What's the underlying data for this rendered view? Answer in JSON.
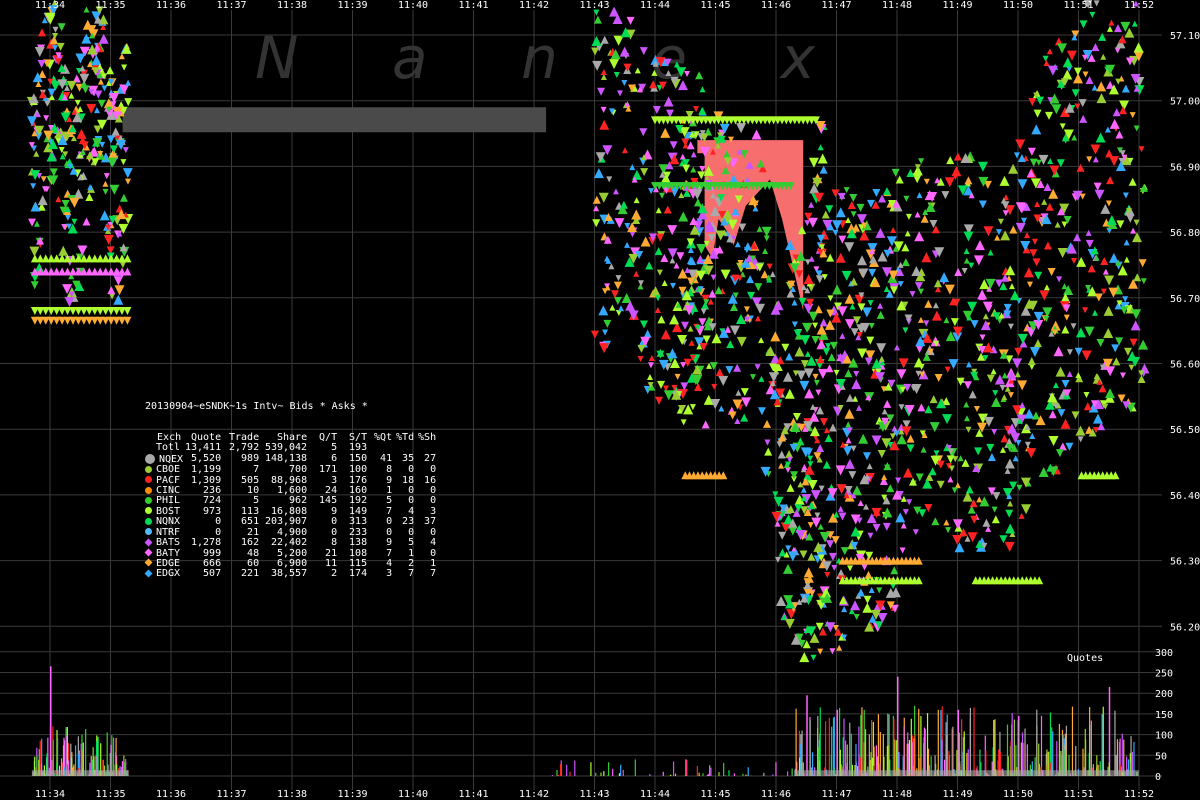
{
  "watermark": "N  a  n  e  x",
  "volume_label": "Quotes",
  "time_labels": [
    "11:34",
    "11:35",
    "11:36",
    "11:37",
    "11:38",
    "11:39",
    "11:40",
    "11:41",
    "11:42",
    "11:43",
    "11:44",
    "11:45",
    "11:46",
    "11:47",
    "11:48",
    "11:49",
    "11:50",
    "11:51",
    "11:52"
  ],
  "price_labels": [
    "57.10",
    "57.00",
    "56.90",
    "56.80",
    "56.70",
    "56.60",
    "56.50",
    "56.40",
    "56.30",
    "56.20"
  ],
  "volume_ticks": [
    "300",
    "250",
    "200",
    "150",
    "100",
    "50",
    "0"
  ],
  "colors": {
    "background": "#000000",
    "grid": "#3a3a3a",
    "nbbo_fill": "#f66e6e",
    "nbbo_gray": "#a8a8a8",
    "stale_bar": "#4a4a4a",
    "NQEX": "#a9a9a9",
    "CBOE": "#9acd32",
    "PACF": "#ff2222",
    "CINC": "#ff8c00",
    "PHIL": "#33cc33",
    "BOST": "#adff2f",
    "NQNX": "#00dd55",
    "NTRF": "#55bbff",
    "BATS": "#cc55ff",
    "BATY": "#ff66ff",
    "EDGE": "#ffaa33",
    "EDGX": "#33aaff"
  },
  "stats": {
    "title": "20130904~eSNDK~1s Intv~ Bids * Asks *",
    "headers": [
      "Exch",
      "Quote",
      "Trade",
      "Share",
      "Q/T",
      "S/T",
      "%Qt",
      "%Td",
      "%Sh"
    ],
    "rows": [
      {
        "exch": "Totl",
        "quote": "13,411",
        "trade": "2,792",
        "share": "539,042",
        "qt": "5",
        "st": "193",
        "pqt": "",
        "ptd": "",
        "psh": "",
        "color": ""
      },
      {
        "exch": "NQEX",
        "quote": "5,520",
        "trade": "989",
        "share": "148,138",
        "qt": "6",
        "st": "150",
        "pqt": "41",
        "ptd": "35",
        "psh": "27",
        "color": "#a9a9a9"
      },
      {
        "exch": "CBOE",
        "quote": "1,199",
        "trade": "7",
        "share": "700",
        "qt": "171",
        "st": "100",
        "pqt": "8",
        "ptd": "0",
        "psh": "0",
        "color": "#9acd32"
      },
      {
        "exch": "PACF",
        "quote": "1,309",
        "trade": "505",
        "share": "88,968",
        "qt": "3",
        "st": "176",
        "pqt": "9",
        "ptd": "18",
        "psh": "16",
        "color": "#ff2222"
      },
      {
        "exch": "CINC",
        "quote": "236",
        "trade": "10",
        "share": "1,600",
        "qt": "24",
        "st": "160",
        "pqt": "1",
        "ptd": "0",
        "psh": "0",
        "color": "#ff8c00"
      },
      {
        "exch": "PHIL",
        "quote": "724",
        "trade": "5",
        "share": "962",
        "qt": "145",
        "st": "192",
        "pqt": "5",
        "ptd": "0",
        "psh": "0",
        "color": "#33cc33"
      },
      {
        "exch": "BOST",
        "quote": "973",
        "trade": "113",
        "share": "16,808",
        "qt": "9",
        "st": "149",
        "pqt": "7",
        "ptd": "4",
        "psh": "3",
        "color": "#adff2f"
      },
      {
        "exch": "NQNX",
        "quote": "0",
        "trade": "651",
        "share": "203,907",
        "qt": "0",
        "st": "313",
        "pqt": "0",
        "ptd": "23",
        "psh": "37",
        "color": "#00dd55"
      },
      {
        "exch": "NTRF",
        "quote": "0",
        "trade": "21",
        "share": "4,900",
        "qt": "0",
        "st": "233",
        "pqt": "0",
        "ptd": "0",
        "psh": "0",
        "color": "#55bbff"
      },
      {
        "exch": "BATS",
        "quote": "1,278",
        "trade": "162",
        "share": "22,402",
        "qt": "8",
        "st": "138",
        "pqt": "9",
        "ptd": "5",
        "psh": "4",
        "color": "#cc55ff"
      },
      {
        "exch": "BATY",
        "quote": "999",
        "trade": "48",
        "share": "5,200",
        "qt": "21",
        "st": "108",
        "pqt": "7",
        "ptd": "1",
        "psh": "0",
        "color": "#ff66ff"
      },
      {
        "exch": "EDGE",
        "quote": "666",
        "trade": "60",
        "share": "6,900",
        "qt": "11",
        "st": "115",
        "pqt": "4",
        "ptd": "2",
        "psh": "1",
        "color": "#ffaa33"
      },
      {
        "exch": "EDGX",
        "quote": "507",
        "trade": "221",
        "share": "38,557",
        "qt": "2",
        "st": "174",
        "pqt": "3",
        "ptd": "7",
        "psh": "7",
        "color": "#33aaff"
      }
    ]
  },
  "chart_data": {
    "type": "scatter",
    "title": "20130904~eSNDK~1s Intv~ Bids * Asks *",
    "xlabel": "",
    "ylabel": "",
    "x_range": [
      "11:33:40",
      "11:52:10"
    ],
    "ylim": [
      56.14,
      57.16
    ],
    "grid": true,
    "series": [
      {
        "name": "NQEX",
        "values": [
          [
            11.34,
            57.02
          ],
          [
            11.345,
            56.96
          ],
          [
            11.44,
            56.93
          ],
          [
            11.465,
            56.5
          ],
          [
            11.47,
            56.36
          ],
          [
            11.48,
            56.55
          ],
          [
            11.5,
            56.7
          ],
          [
            11.515,
            56.92
          ]
        ]
      },
      {
        "name": "PACF",
        "values": [
          [
            11.445,
            56.83
          ],
          [
            11.455,
            56.86
          ],
          [
            11.463,
            56.6
          ],
          [
            11.475,
            56.66
          ],
          [
            11.49,
            56.62
          ]
        ]
      },
      {
        "name": "PHIL",
        "values": [
          [
            11.343,
            56.98
          ],
          [
            11.44,
            56.99
          ],
          [
            11.452,
            56.7
          ],
          [
            11.47,
            56.21
          ],
          [
            11.485,
            56.42
          ],
          [
            11.51,
            56.8
          ]
        ]
      },
      {
        "name": "BATS",
        "values": [
          [
            11.345,
            57.0
          ],
          [
            11.43,
            56.94
          ],
          [
            11.445,
            56.74
          ],
          [
            11.465,
            56.3
          ],
          [
            11.49,
            56.33
          ],
          [
            11.515,
            56.62
          ]
        ]
      },
      {
        "name": "EDGE",
        "values": [
          [
            11.34,
            56.67
          ],
          [
            11.443,
            56.41
          ],
          [
            11.475,
            56.32
          ],
          [
            11.5,
            56.3
          ]
        ]
      }
    ],
    "volume": {
      "title": "Quotes",
      "ylim": [
        0,
        300
      ],
      "peaks": [
        [
          11.34,
          265
        ],
        [
          11.35,
          75
        ],
        [
          11.445,
          40
        ],
        [
          11.465,
          195
        ],
        [
          11.47,
          160
        ],
        [
          11.48,
          240
        ],
        [
          11.49,
          160
        ],
        [
          11.5,
          145
        ],
        [
          11.515,
          215
        ]
      ]
    }
  }
}
